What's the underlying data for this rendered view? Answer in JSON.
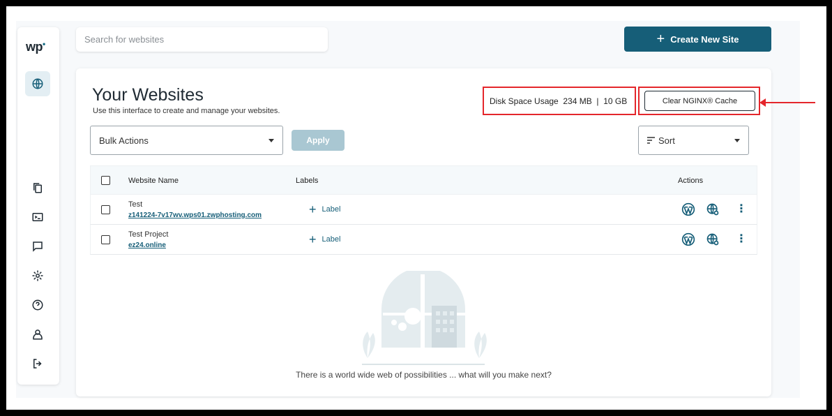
{
  "app": {
    "logo": "wp"
  },
  "search": {
    "placeholder": "Search for websites"
  },
  "header": {
    "create_label": "Create New Site"
  },
  "main": {
    "title": "Your Websites",
    "subtitle": "Use this interface to create and manage your websites.",
    "disk_usage": "Disk Space Usage  234 MB  |  10 GB",
    "clear_cache_label": "Clear NGINX® Cache",
    "bulk_actions": "Bulk Actions",
    "apply_label": "Apply",
    "sort_label": "Sort"
  },
  "table": {
    "columns": [
      "Website Name",
      "Labels",
      "Actions"
    ],
    "rows": [
      {
        "name": "Test",
        "url": "z141224-7v17wv.wps01.zwphosting.com",
        "label_action": "Label"
      },
      {
        "name": "Test Project",
        "url": "ez24.online",
        "label_action": "Label"
      }
    ]
  },
  "empty_state": {
    "message": "There is a world wide web of possibilities ... what will you make next?"
  },
  "colors": {
    "brand": "#165e78",
    "annotation": "#e4262b",
    "apply_disabled": "#a9c7d2"
  },
  "icons": {
    "sidebar": [
      "globe-icon",
      "pages-icon",
      "terminal-icon",
      "chat-icon",
      "gear-icon",
      "help-icon",
      "user-icon",
      "logout-icon"
    ],
    "row_actions": [
      "wordpress-icon",
      "globe-settings-icon",
      "kebab-menu-icon"
    ]
  }
}
